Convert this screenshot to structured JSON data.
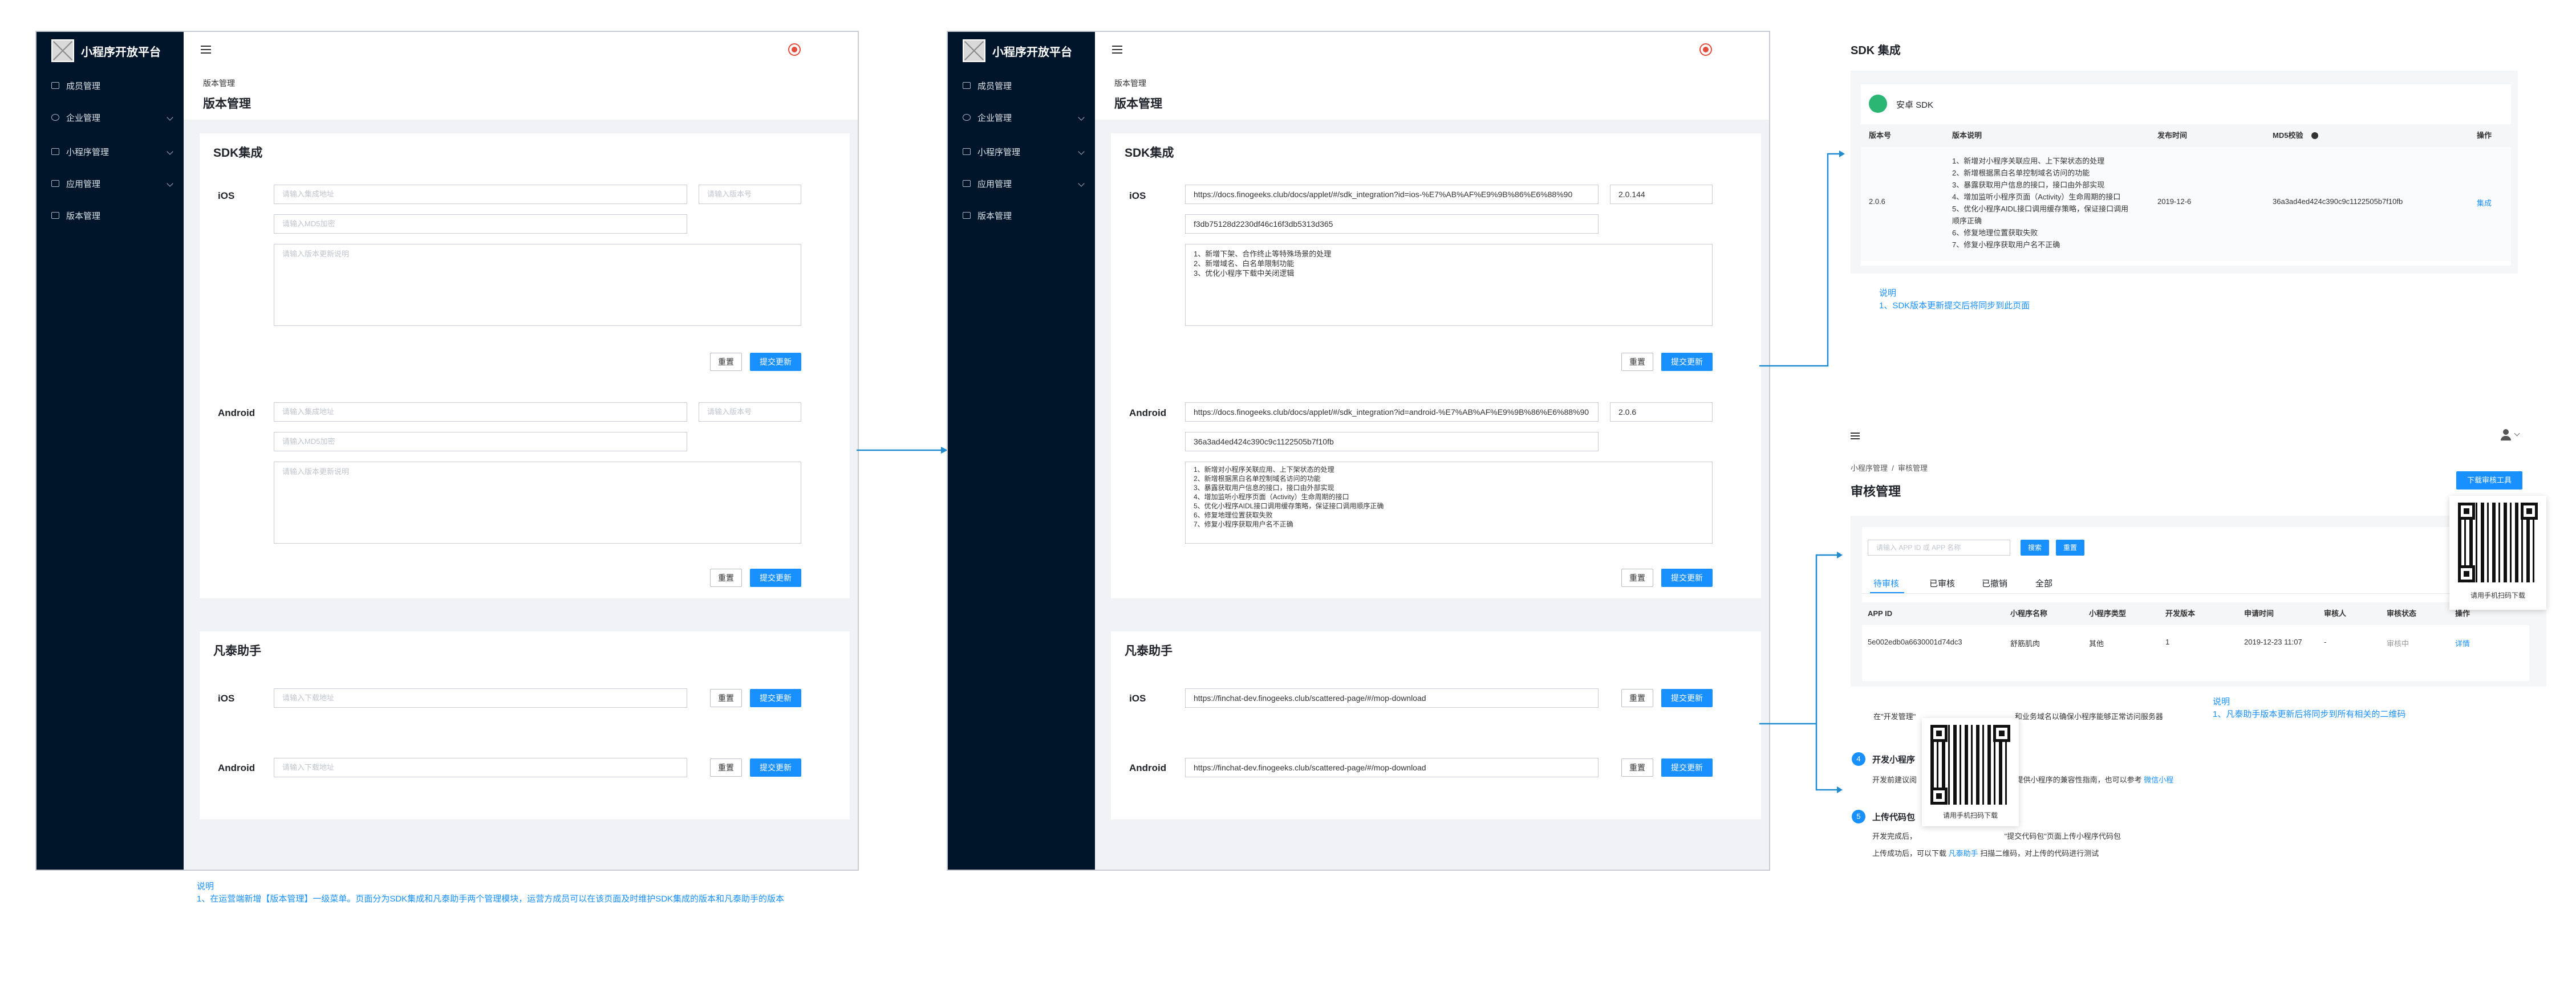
{
  "app": {
    "name": "小程序开放平台",
    "nav": [
      "成员管理",
      "企业管理",
      "小程序管理",
      "应用管理",
      "版本管理"
    ],
    "breadcrumb": "版本管理",
    "page_title": "版本管理"
  },
  "sdk_card_title": "SDK集成",
  "fantai_card_title": "凡泰助手",
  "labels": {
    "ios": "iOS",
    "android": "Android",
    "reset": "重置",
    "submit": "提交更新"
  },
  "placeholders": {
    "sdk_url": "请输入集成地址",
    "version": "请输入版本号",
    "md5": "请输入MD5加密",
    "update_desc": "请输入版本更新说明",
    "download_url": "请输入下载地址"
  },
  "filled": {
    "ios_url": "https://docs.finogeeks.club/docs/applet/#/sdk_integration?id=ios-%E7%AB%AF%E9%9B%86%E6%88%90",
    "ios_version": "2.0.144",
    "ios_md5": "f3db75128d2230df46c16f3db5313d365",
    "ios_desc": [
      "1、新增下架、合作终止等特殊场景的处理",
      "2、新增域名、白名单限制功能",
      "3、优化小程序下载中关闭逻辑"
    ],
    "android_url": "https://docs.finogeeks.club/docs/applet/#/sdk_integration?id=android-%E7%AB%AF%E9%9B%86%E6%88%90",
    "android_version": "2.0.6",
    "android_md5": "36a3ad4ed424c390c9c1122505b7f10fb",
    "android_desc": [
      "1、新增对小程序关联应用、上下架状态的处理",
      "2、新增根据黑白名单控制域名访问的功能",
      "3、暴露获取用户信息的接口，接口由外部实现",
      "4、增加监听小程序页面（Activity）生命周期的接口",
      "5、优化小程序AIDL接口调用缓存策略，保证接口调用顺序正确",
      "6、修复地理位置获取失败",
      "7、修复小程序获取用户名不正确"
    ],
    "ios_download": "https://finchat-dev.finogeeks.club/scattered-page/#/mop-download",
    "android_download": "https://finchat-dev.finogeeks.club/scattered-page/#/mop-download"
  },
  "note1": {
    "title": "说明",
    "text": "1、在运营端新增【版本管理】一级菜单。页面分为SDK集成和凡泰助手两个管理模块，运营方成员可以在该页面及时维护SDK集成的版本和凡泰助手的版本"
  },
  "sdk_panel": {
    "title": "SDK 集成",
    "tab": "安卓 SDK",
    "columns": [
      "版本号",
      "版本说明",
      "发布时间",
      "MD5校验",
      "操作"
    ],
    "row": {
      "version": "2.0.6",
      "desc": [
        "1、新增对小程序关联应用、上下架状态的处理",
        "2、新增根据黑白名单控制域名访问的功能",
        "3、暴露获取用户信息的接口，接口由外部实现",
        "4、增加监听小程序页面（Activity）生命周期的接口",
        "5、优化小程序AIDL接口调用缓存策略，保证接口调用",
        "顺序正确",
        "6、修复地理位置获取失败",
        "7、修复小程序获取用户名不正确"
      ],
      "date": "2019-12-6",
      "md5": "36a3ad4ed424c390c9c1122505b7f10fb",
      "action": "集成"
    },
    "note_title": "说明",
    "note_text": "1、SDK版本更新提交后将同步到此页面"
  },
  "audit_panel": {
    "breadcrumb": "小程序管理  /  审核管理",
    "title": "审核管理",
    "download_btn": "下载审核工具",
    "search_placeholder": "请输入 APP ID 或 APP 名称",
    "search_btn": "搜索",
    "reset_btn": "重置",
    "tabs": [
      "待审核",
      "已审核",
      "已撤销",
      "全部"
    ],
    "columns": [
      "APP ID",
      "小程序名称",
      "小程序类型",
      "开发版本",
      "申请时间",
      "审核人",
      "审核状态",
      "操作"
    ],
    "row": [
      "5e002edb0a6630001d74dc3",
      "舒筋肌肉",
      "其他",
      "1",
      "2019-12-23 11:07",
      "-",
      "审核中",
      "详情"
    ],
    "qr_caption": "请用手机扫码下载",
    "qr_caption2": "请用手机扫码下载",
    "note_title": "说明",
    "note_text": "1、凡泰助手版本更新后将同步到所有相关的二维码",
    "steps": {
      "line1a": "在\"开发管理\"",
      "line1b": "和业务域名以确保小程序能够正常访问服务器",
      "step4_num": "4",
      "step4_title": "开发小程序",
      "step4_a": "开发前建议阅",
      "step4_b": "提供小程序的兼容性指南，也可以参考",
      "step4_link": "微信小程",
      "step5_num": "5",
      "step5_title": "上传代码包",
      "step5_a": "开发完成后，",
      "step5_b": "\"提交代码包\"页面上传小程序代码包",
      "step5_c": "上传成功后，可以下载",
      "step5_link": "凡泰助手",
      "step5_d": "扫描二维码，对上传的代码进行测试"
    }
  },
  "colors": {
    "sidebar": "#001529",
    "primary": "#1890ff",
    "arrow": "#1f8ccf"
  }
}
